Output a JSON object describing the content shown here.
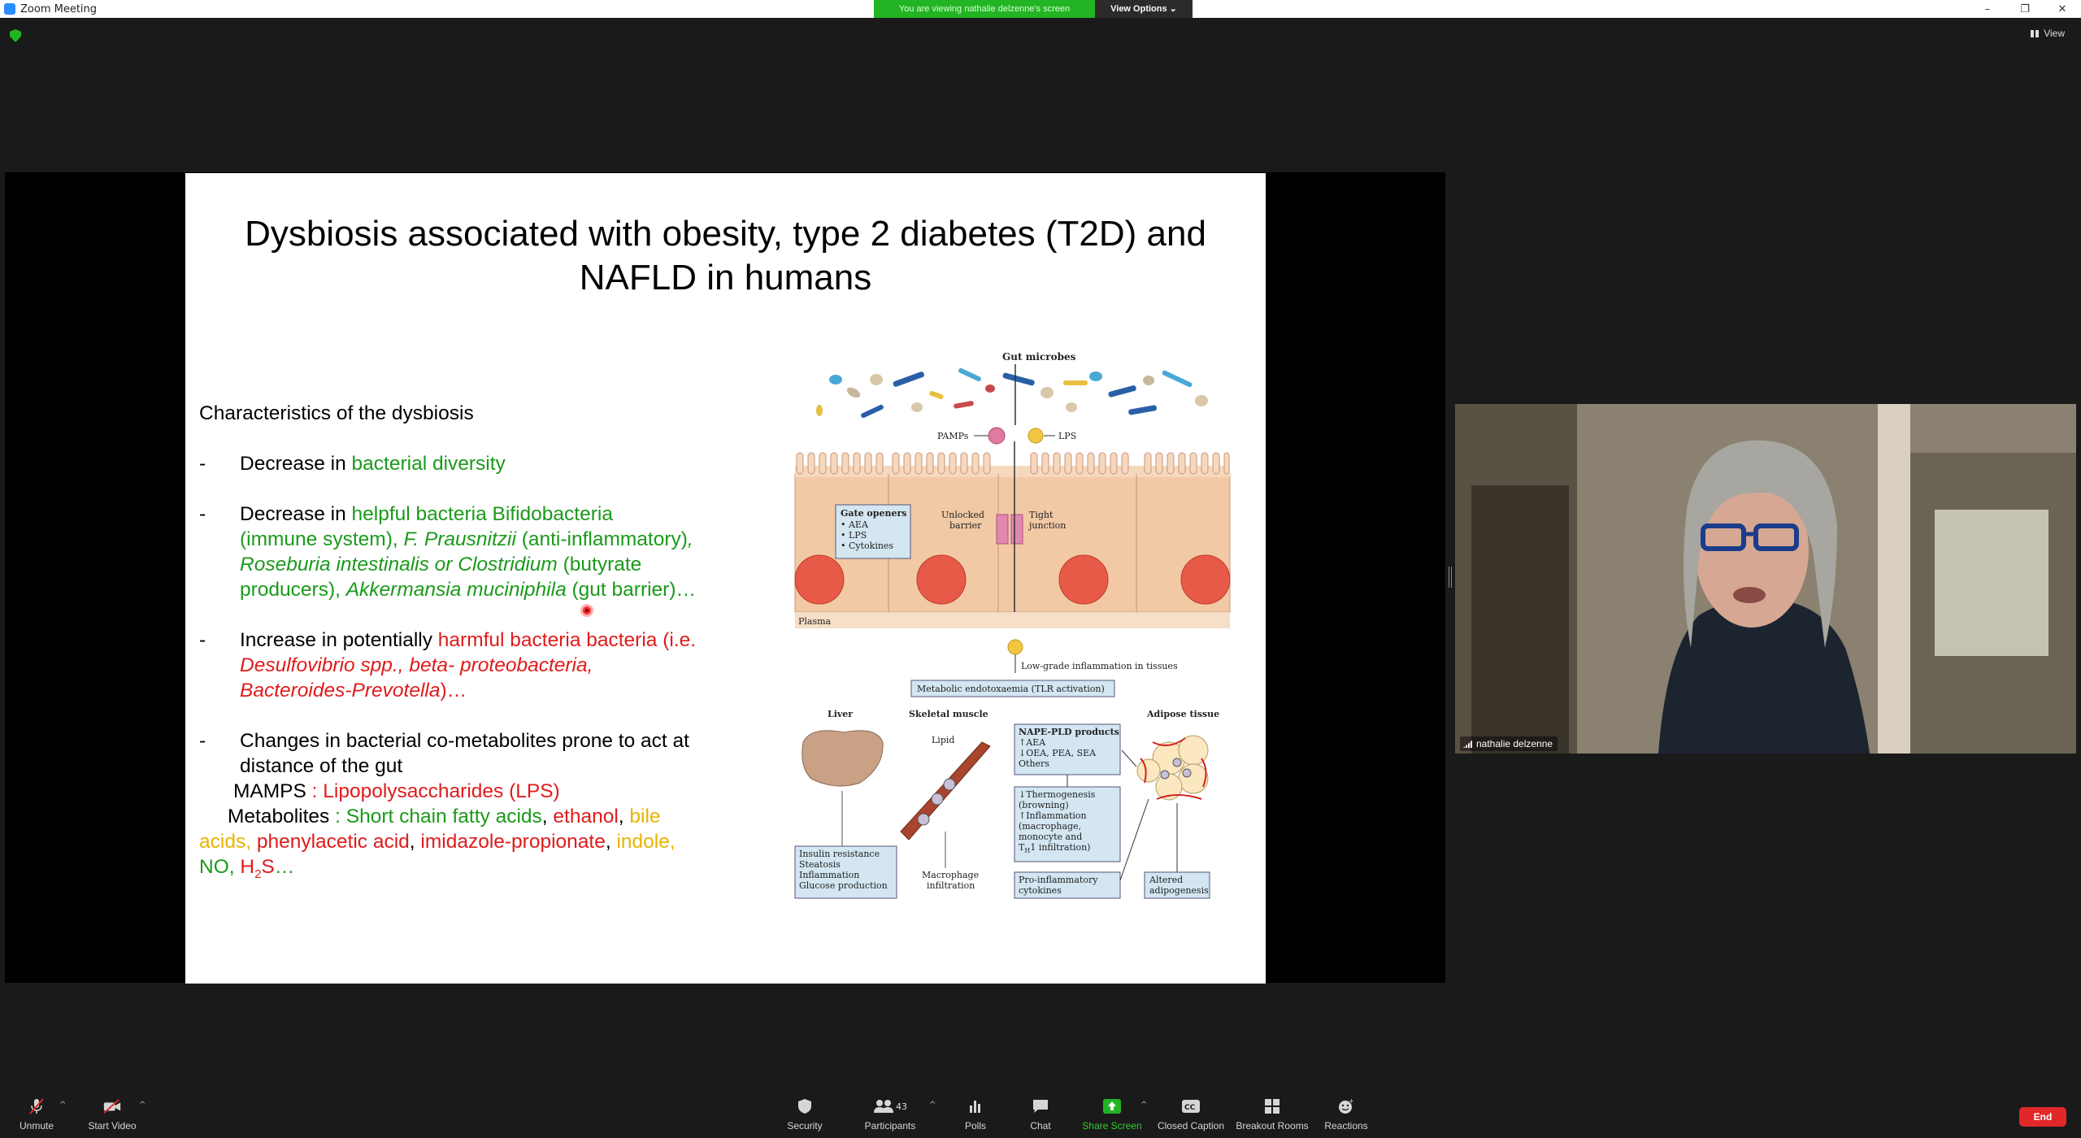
{
  "window": {
    "title": "Zoom Meeting",
    "controls": [
      "–",
      "❐",
      "✕"
    ]
  },
  "banner": {
    "viewing_text": "You are viewing nathalie delzenne's screen",
    "view_options": "View Options ⌄"
  },
  "view_button": "View",
  "slide": {
    "title_line1": "Dysbiosis associated with obesity, type 2 diabetes (T2D) and",
    "title_line2": "NAFLD  in humans",
    "heading": "Characteristics of the dysbiosis",
    "b1": {
      "dash": "-",
      "t1": "Decrease in ",
      "t2": "bacterial diversity"
    },
    "b2": {
      "dash": "-",
      "t1": "Decrease in ",
      "t2": "helpful bacteria  Bifidobacteria",
      "t3": "(immune system), ",
      "t4": "F. Prausnitzii",
      "t5": " (anti-inflammatory)",
      "t6": ",",
      "t7": "Roseburia intestinalis or Clostridium",
      "t8": " (butyrate",
      "t9": "producers), ",
      "t10": "Akkermansia muciniphila",
      "t11": " (gut barrier)…"
    },
    "b3": {
      "dash": "-",
      "t1": "Increase in potentially ",
      "t2": "harmful bacteria bacteria (i.e.",
      "t3": "Desulfovibrio spp.,  beta- proteobacteria,",
      "t4": "Bacteroides-Prevotella",
      "t5": ")…"
    },
    "b4": {
      "dash": "-",
      "t1": "Changes in bacterial co-metabolites  prone to act at",
      "t2": "distance of the gut",
      "mamps_label": "MAMPS ",
      "mamps_value": ": Lipopolysaccharides (LPS)",
      "metab_label": "Metabolites ",
      "m1": ": Short chain fatty acids",
      "m2": ", ",
      "m3": "ethanol",
      "m4": ", ",
      "m5": "bile",
      "m6": "acids,",
      "m7": " phenylacetic  acid",
      "m8": ",  ",
      "m9": "imidazole-propionate",
      "m10": ", ",
      "m11": "indole,",
      "m12": "NO, ",
      "m13": "H",
      "m14": "2",
      "m15": "S",
      "m16": "…"
    },
    "diagram": {
      "gut_microbes": "Gut microbes",
      "pamps": "PAMPs",
      "lps": "LPS",
      "gate_openers": "Gate openers",
      "gate_items": [
        "• AEA",
        "• LPS",
        "• Cytokines"
      ],
      "unlocked_barrier_1": "Unlocked",
      "unlocked_barrier_2": "barrier",
      "tight_junction_1": "Tight",
      "tight_junction_2": "junction",
      "plasma": "Plasma",
      "low_grade": "Low-grade inflammation in tissues",
      "metabolic_endotox": "Metabolic endotoxaemia (TLR activation)",
      "liver": "Liver",
      "skeletal_muscle": "Skeletal muscle",
      "adipose": "Adipose tissue",
      "lipid": "Lipid",
      "nape_title": "NAPE-PLD products",
      "nape_items": [
        "↑AEA",
        "↓OEA, PEA, SEA",
        "Others"
      ],
      "thermo_items": [
        "↓Thermogenesis",
        "(browning)",
        "↑Inflammation",
        "(macrophage,",
        "monocyte and",
        "T",
        "H",
        "1 infiltration)"
      ],
      "liver_items": [
        "Insulin resistance",
        "Steatosis",
        "Inflammation",
        "Glucose production"
      ],
      "macrophage_1": "Macrophage",
      "macrophage_2": "infiltration",
      "proinflam_1": "Pro-inflammatory",
      "proinflam_2": "cytokines",
      "altered_1": "Altered",
      "altered_2": "adipogenesis"
    }
  },
  "participant": {
    "name": "nathalie delzenne"
  },
  "toolbar": {
    "unmute": "Unmute",
    "start_video": "Start Video",
    "security": "Security",
    "participants": "Participants",
    "participants_count": "43",
    "polls": "Polls",
    "chat": "Chat",
    "share_screen": "Share Screen",
    "closed_caption": "Closed Caption",
    "breakout_rooms": "Breakout Rooms",
    "reactions": "Reactions",
    "end": "End"
  },
  "colors": {
    "green_text": "#1a9a1a",
    "red_text": "#e01b1b",
    "yellow_text": "#e8b400",
    "share_banner": "#23b423",
    "end_button": "#e02828"
  }
}
